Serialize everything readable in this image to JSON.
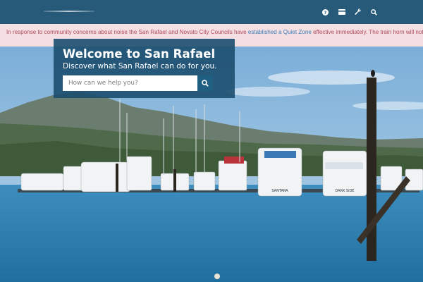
{
  "header": {
    "icons": [
      "help-icon",
      "card-icon",
      "wrench-icon",
      "search-icon"
    ]
  },
  "alert": {
    "text_before": "In response to community concerns about noise the San Rafael and Novato City Councils have ",
    "link_text": "established a Quiet Zone",
    "text_after": " effective immediately. The train horn will not blow at"
  },
  "welcome": {
    "title": "Welcome to San Rafael",
    "subtitle": "Discover what San Rafael can do for you.",
    "search_placeholder": "How can we help you?"
  },
  "hero": {
    "boat_names": [
      "SANTARA",
      "DARK SIDE"
    ]
  },
  "colors": {
    "header_bg": "#265a78",
    "alert_bg": "#f4dfe3",
    "alert_text": "#b04a5a",
    "link": "#3e7cb4",
    "panel_bg": "#1c4e6e",
    "search_button": "#1f5f82"
  }
}
